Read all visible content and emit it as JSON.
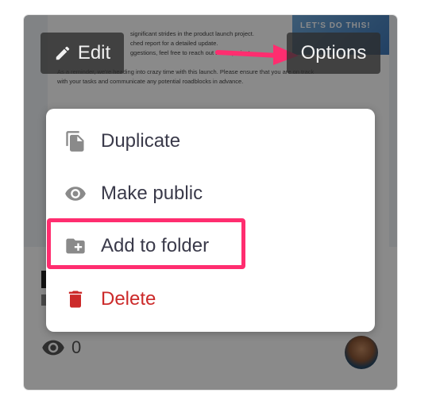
{
  "document_preview": {
    "lines": [
      "",
      "significant strides in the product launch project.",
      "ched report for a detailed update.",
      "ggestions, feel free to reach out to the project",
      "As a reminder, we're heading into crazy time with this launch. Please ensure that you are on track",
      "with your tasks and communicate any potential roadblocks in advance."
    ],
    "hero_text": "LET'S DO THIS!"
  },
  "toolbar": {
    "edit_label": "Edit",
    "options_label": "Options"
  },
  "menu": {
    "items": [
      {
        "label": "Duplicate",
        "icon": "file-copy-icon"
      },
      {
        "label": "Make public",
        "icon": "eye-icon"
      },
      {
        "label": "Add to folder",
        "icon": "folder-add-icon"
      },
      {
        "label": "Delete",
        "icon": "trash-icon"
      }
    ]
  },
  "card": {
    "view_count": "0"
  },
  "colors": {
    "highlight": "#ff2d6f",
    "danger": "#cc2a2a",
    "menu_text": "#3a3a4a"
  }
}
